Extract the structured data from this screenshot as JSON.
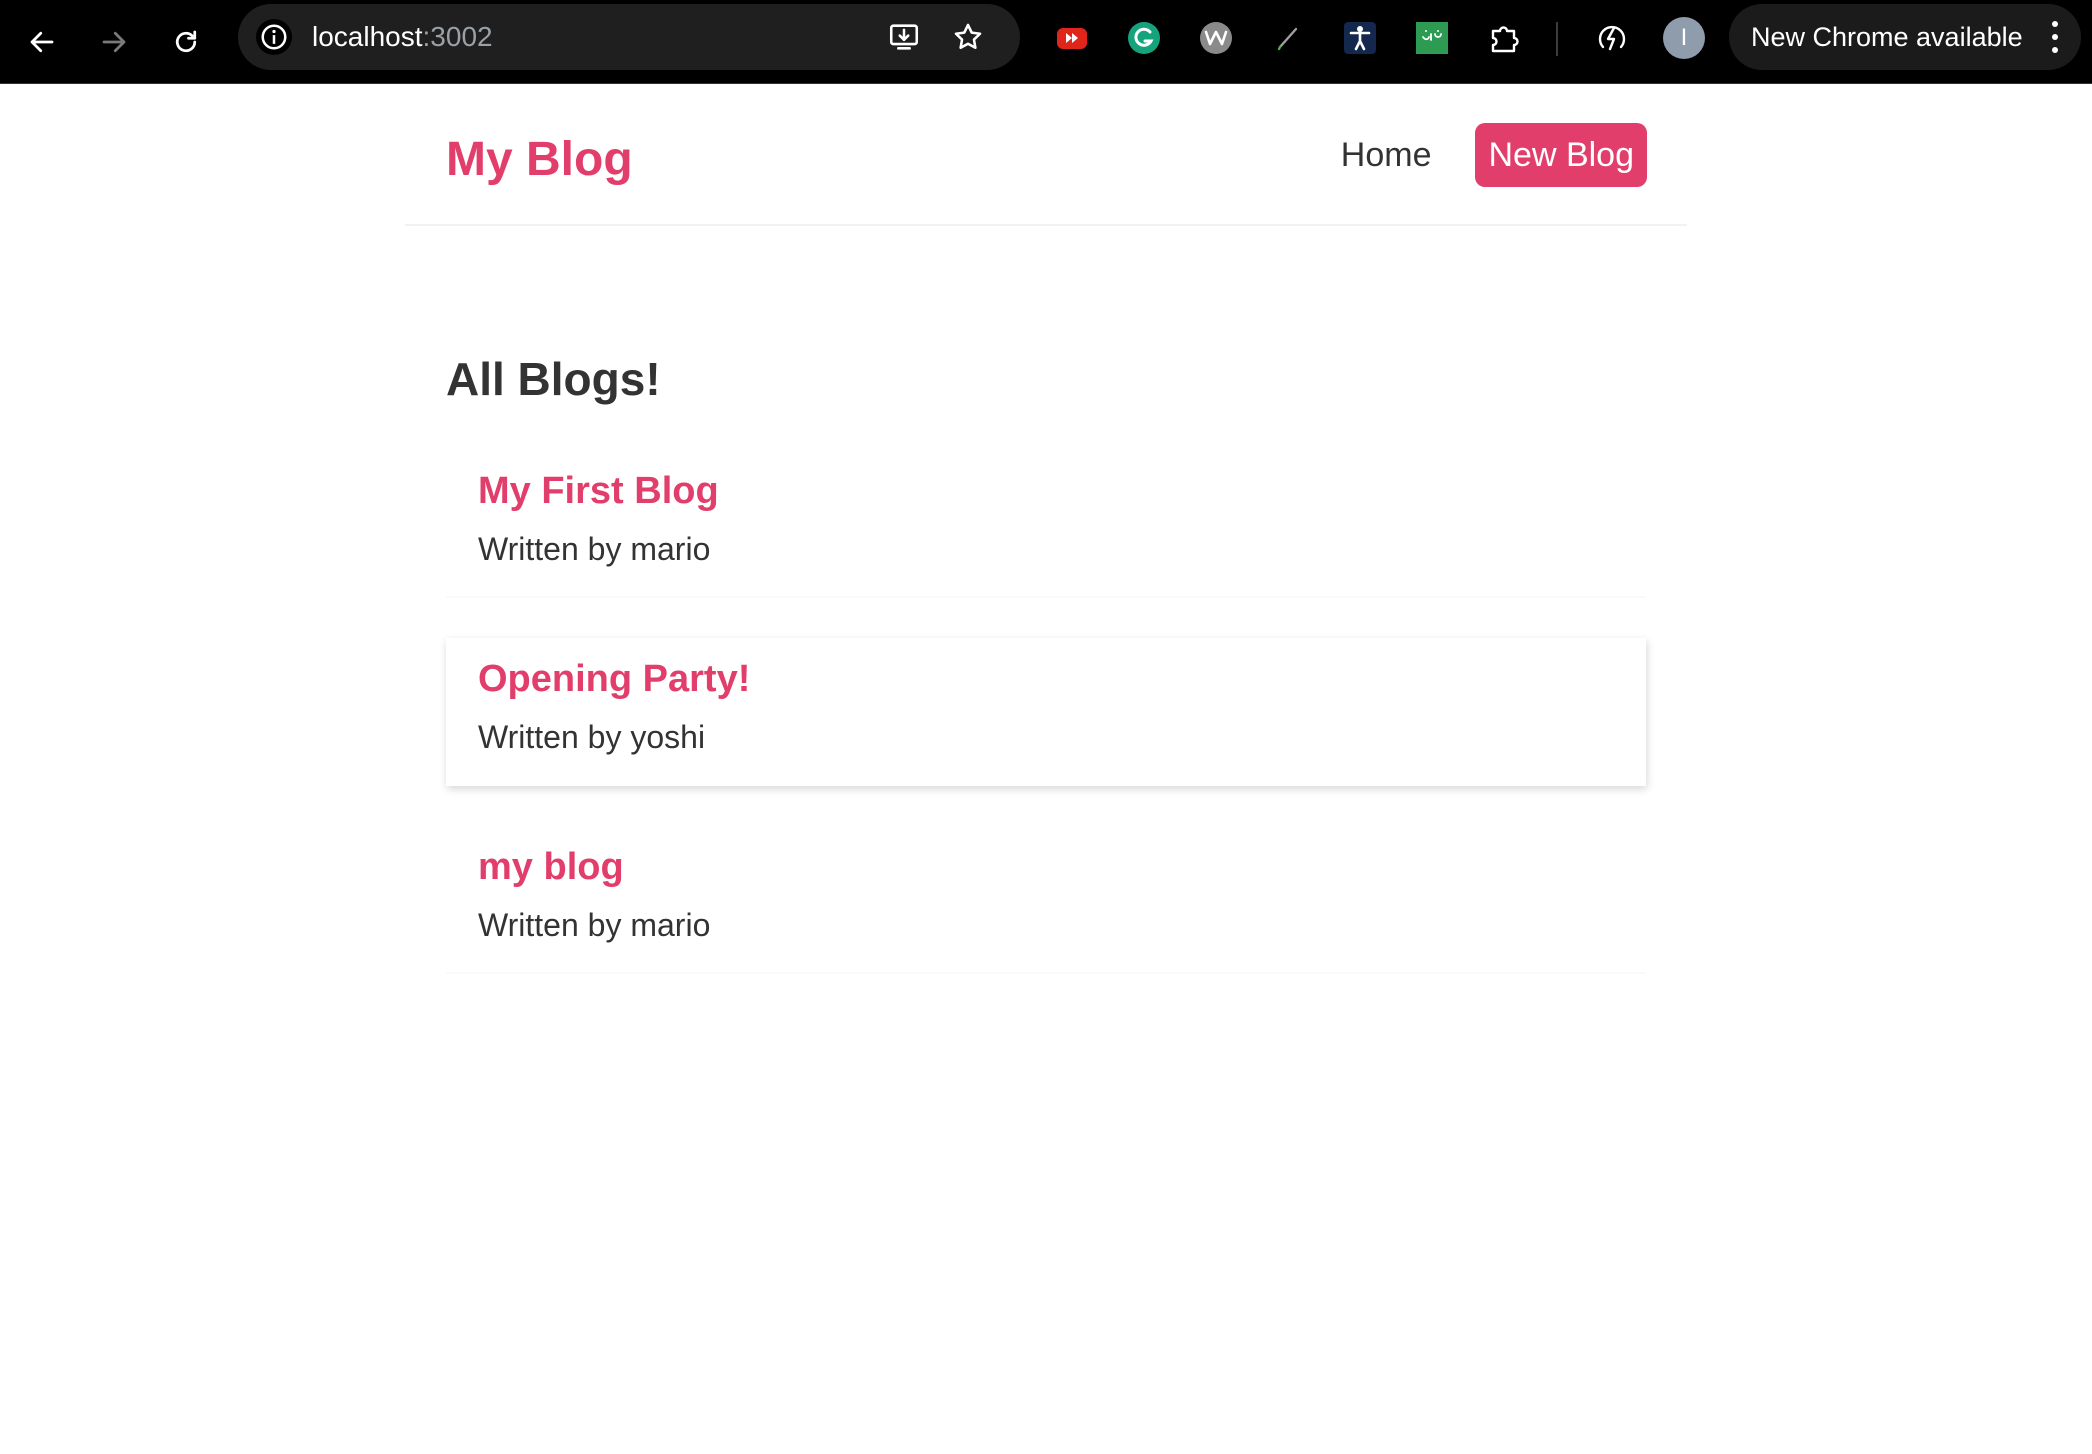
{
  "browser": {
    "url_host": "localhost",
    "url_port": ":3002",
    "update_label": "New Chrome available",
    "avatar_initial": "I",
    "extensions": [
      "youtube-extension-icon",
      "grammarly-icon",
      "wave-icon",
      "pen-icon",
      "accessibility-icon",
      "arabic-keyboard-icon",
      "extensions-puzzle-icon",
      "performance-icon"
    ]
  },
  "navbar": {
    "brand": "My Blog",
    "home_label": "Home",
    "new_blog_label": "New Blog"
  },
  "main": {
    "title": "All Blogs!",
    "blogs": [
      {
        "title": "My First Blog",
        "author": "Written by mario"
      },
      {
        "title": "Opening Party!",
        "author": "Written by yoshi"
      },
      {
        "title": "my blog",
        "author": "Written by mario"
      }
    ]
  },
  "colors": {
    "accent": "#e23e6b",
    "text": "#333333",
    "chrome_bg": "#000000"
  }
}
